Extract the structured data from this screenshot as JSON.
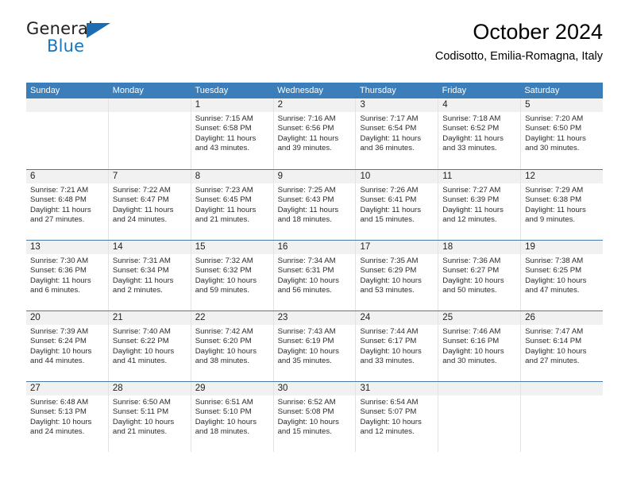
{
  "brand": {
    "name_top": "General",
    "name_bottom": "Blue",
    "triangle_color": "#1b6cb0",
    "blue_color": "#1b75bb"
  },
  "header": {
    "title": "October 2024",
    "subtitle": "Codisotto, Emilia-Romagna, Italy"
  },
  "calendar": {
    "accent_color": "#3b7eba",
    "daynum_band_color": "#f1f1f1",
    "weekday_headers": [
      "Sunday",
      "Monday",
      "Tuesday",
      "Wednesday",
      "Thursday",
      "Friday",
      "Saturday"
    ],
    "weeks": [
      [
        {
          "day": "",
          "empty": true
        },
        {
          "day": "",
          "empty": true
        },
        {
          "day": "1",
          "sunrise": "Sunrise: 7:15 AM",
          "sunset": "Sunset: 6:58 PM",
          "daylight1": "Daylight: 11 hours",
          "daylight2": "and 43 minutes."
        },
        {
          "day": "2",
          "sunrise": "Sunrise: 7:16 AM",
          "sunset": "Sunset: 6:56 PM",
          "daylight1": "Daylight: 11 hours",
          "daylight2": "and 39 minutes."
        },
        {
          "day": "3",
          "sunrise": "Sunrise: 7:17 AM",
          "sunset": "Sunset: 6:54 PM",
          "daylight1": "Daylight: 11 hours",
          "daylight2": "and 36 minutes."
        },
        {
          "day": "4",
          "sunrise": "Sunrise: 7:18 AM",
          "sunset": "Sunset: 6:52 PM",
          "daylight1": "Daylight: 11 hours",
          "daylight2": "and 33 minutes."
        },
        {
          "day": "5",
          "sunrise": "Sunrise: 7:20 AM",
          "sunset": "Sunset: 6:50 PM",
          "daylight1": "Daylight: 11 hours",
          "daylight2": "and 30 minutes."
        }
      ],
      [
        {
          "day": "6",
          "sunrise": "Sunrise: 7:21 AM",
          "sunset": "Sunset: 6:48 PM",
          "daylight1": "Daylight: 11 hours",
          "daylight2": "and 27 minutes."
        },
        {
          "day": "7",
          "sunrise": "Sunrise: 7:22 AM",
          "sunset": "Sunset: 6:47 PM",
          "daylight1": "Daylight: 11 hours",
          "daylight2": "and 24 minutes."
        },
        {
          "day": "8",
          "sunrise": "Sunrise: 7:23 AM",
          "sunset": "Sunset: 6:45 PM",
          "daylight1": "Daylight: 11 hours",
          "daylight2": "and 21 minutes."
        },
        {
          "day": "9",
          "sunrise": "Sunrise: 7:25 AM",
          "sunset": "Sunset: 6:43 PM",
          "daylight1": "Daylight: 11 hours",
          "daylight2": "and 18 minutes."
        },
        {
          "day": "10",
          "sunrise": "Sunrise: 7:26 AM",
          "sunset": "Sunset: 6:41 PM",
          "daylight1": "Daylight: 11 hours",
          "daylight2": "and 15 minutes."
        },
        {
          "day": "11",
          "sunrise": "Sunrise: 7:27 AM",
          "sunset": "Sunset: 6:39 PM",
          "daylight1": "Daylight: 11 hours",
          "daylight2": "and 12 minutes."
        },
        {
          "day": "12",
          "sunrise": "Sunrise: 7:29 AM",
          "sunset": "Sunset: 6:38 PM",
          "daylight1": "Daylight: 11 hours",
          "daylight2": "and 9 minutes."
        }
      ],
      [
        {
          "day": "13",
          "sunrise": "Sunrise: 7:30 AM",
          "sunset": "Sunset: 6:36 PM",
          "daylight1": "Daylight: 11 hours",
          "daylight2": "and 6 minutes."
        },
        {
          "day": "14",
          "sunrise": "Sunrise: 7:31 AM",
          "sunset": "Sunset: 6:34 PM",
          "daylight1": "Daylight: 11 hours",
          "daylight2": "and 2 minutes."
        },
        {
          "day": "15",
          "sunrise": "Sunrise: 7:32 AM",
          "sunset": "Sunset: 6:32 PM",
          "daylight1": "Daylight: 10 hours",
          "daylight2": "and 59 minutes."
        },
        {
          "day": "16",
          "sunrise": "Sunrise: 7:34 AM",
          "sunset": "Sunset: 6:31 PM",
          "daylight1": "Daylight: 10 hours",
          "daylight2": "and 56 minutes."
        },
        {
          "day": "17",
          "sunrise": "Sunrise: 7:35 AM",
          "sunset": "Sunset: 6:29 PM",
          "daylight1": "Daylight: 10 hours",
          "daylight2": "and 53 minutes."
        },
        {
          "day": "18",
          "sunrise": "Sunrise: 7:36 AM",
          "sunset": "Sunset: 6:27 PM",
          "daylight1": "Daylight: 10 hours",
          "daylight2": "and 50 minutes."
        },
        {
          "day": "19",
          "sunrise": "Sunrise: 7:38 AM",
          "sunset": "Sunset: 6:25 PM",
          "daylight1": "Daylight: 10 hours",
          "daylight2": "and 47 minutes."
        }
      ],
      [
        {
          "day": "20",
          "sunrise": "Sunrise: 7:39 AM",
          "sunset": "Sunset: 6:24 PM",
          "daylight1": "Daylight: 10 hours",
          "daylight2": "and 44 minutes."
        },
        {
          "day": "21",
          "sunrise": "Sunrise: 7:40 AM",
          "sunset": "Sunset: 6:22 PM",
          "daylight1": "Daylight: 10 hours",
          "daylight2": "and 41 minutes."
        },
        {
          "day": "22",
          "sunrise": "Sunrise: 7:42 AM",
          "sunset": "Sunset: 6:20 PM",
          "daylight1": "Daylight: 10 hours",
          "daylight2": "and 38 minutes."
        },
        {
          "day": "23",
          "sunrise": "Sunrise: 7:43 AM",
          "sunset": "Sunset: 6:19 PM",
          "daylight1": "Daylight: 10 hours",
          "daylight2": "and 35 minutes."
        },
        {
          "day": "24",
          "sunrise": "Sunrise: 7:44 AM",
          "sunset": "Sunset: 6:17 PM",
          "daylight1": "Daylight: 10 hours",
          "daylight2": "and 33 minutes."
        },
        {
          "day": "25",
          "sunrise": "Sunrise: 7:46 AM",
          "sunset": "Sunset: 6:16 PM",
          "daylight1": "Daylight: 10 hours",
          "daylight2": "and 30 minutes."
        },
        {
          "day": "26",
          "sunrise": "Sunrise: 7:47 AM",
          "sunset": "Sunset: 6:14 PM",
          "daylight1": "Daylight: 10 hours",
          "daylight2": "and 27 minutes."
        }
      ],
      [
        {
          "day": "27",
          "sunrise": "Sunrise: 6:48 AM",
          "sunset": "Sunset: 5:13 PM",
          "daylight1": "Daylight: 10 hours",
          "daylight2": "and 24 minutes."
        },
        {
          "day": "28",
          "sunrise": "Sunrise: 6:50 AM",
          "sunset": "Sunset: 5:11 PM",
          "daylight1": "Daylight: 10 hours",
          "daylight2": "and 21 minutes."
        },
        {
          "day": "29",
          "sunrise": "Sunrise: 6:51 AM",
          "sunset": "Sunset: 5:10 PM",
          "daylight1": "Daylight: 10 hours",
          "daylight2": "and 18 minutes."
        },
        {
          "day": "30",
          "sunrise": "Sunrise: 6:52 AM",
          "sunset": "Sunset: 5:08 PM",
          "daylight1": "Daylight: 10 hours",
          "daylight2": "and 15 minutes."
        },
        {
          "day": "31",
          "sunrise": "Sunrise: 6:54 AM",
          "sunset": "Sunset: 5:07 PM",
          "daylight1": "Daylight: 10 hours",
          "daylight2": "and 12 minutes."
        },
        {
          "day": "",
          "empty": true
        },
        {
          "day": "",
          "empty": true
        }
      ]
    ]
  }
}
